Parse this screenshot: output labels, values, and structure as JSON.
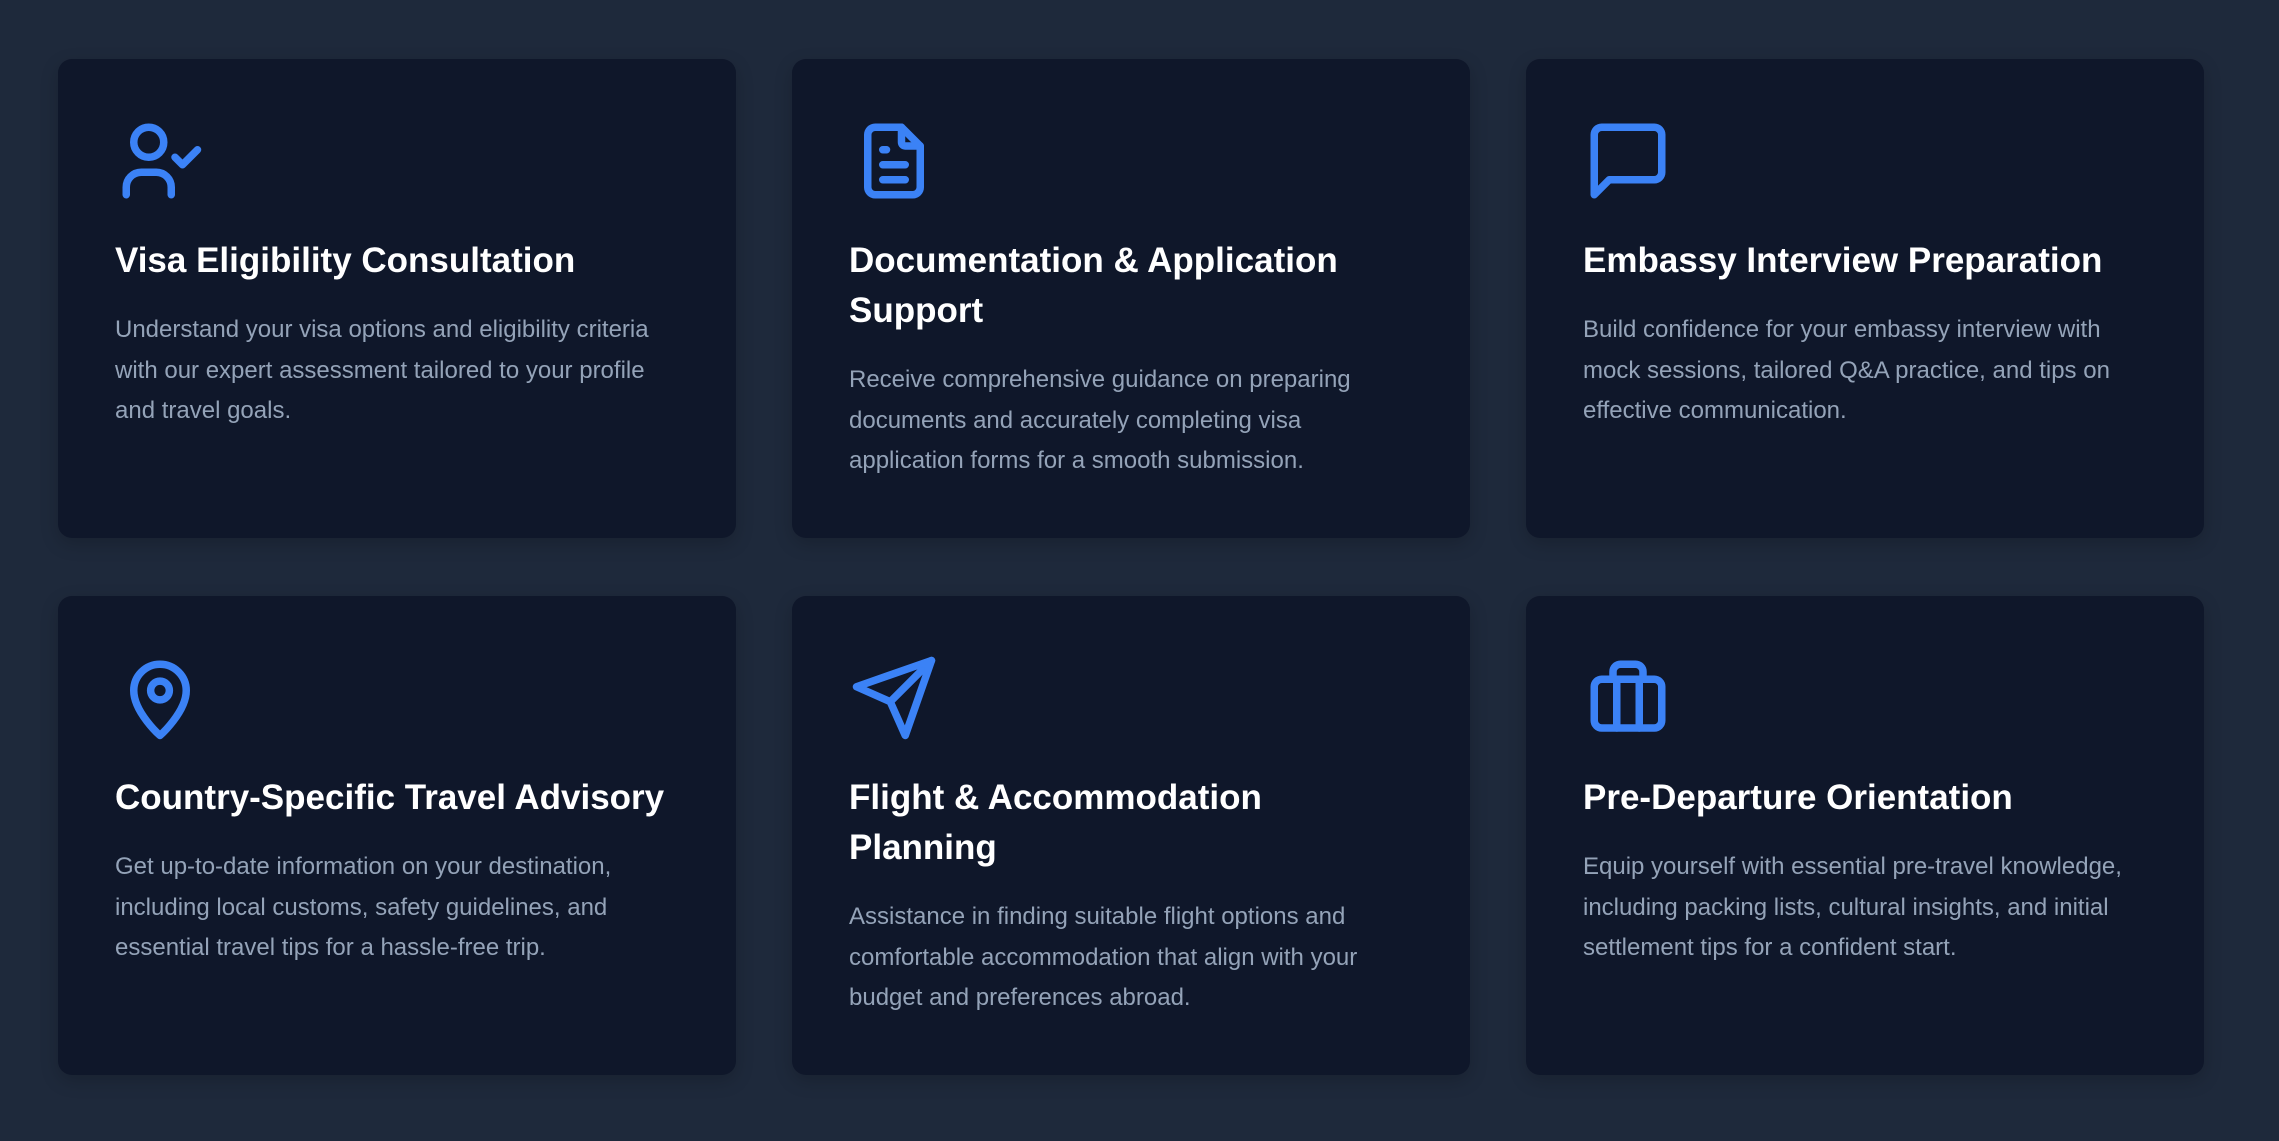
{
  "theme": {
    "background": "#1e293b",
    "card_background": "#0f172a",
    "accent": "#3b82f6",
    "title_color": "#ffffff",
    "text_color": "#94a3b8"
  },
  "services": [
    {
      "icon": "user-check-icon",
      "title": "Visa Eligibility Consultation",
      "description": "Understand your visa options and eligibility criteria with our expert assessment tailored to your profile and travel goals."
    },
    {
      "icon": "document-icon",
      "title": "Documentation & Application Support",
      "description": "Receive comprehensive guidance on preparing documents and accurately completing visa application forms for a smooth submission."
    },
    {
      "icon": "chat-bubble-icon",
      "title": "Embassy Interview Preparation",
      "description": "Build confidence for your embassy interview with mock sessions, tailored Q&A practice, and tips on effective communication."
    },
    {
      "icon": "map-pin-icon",
      "title": "Country-Specific Travel Advisory",
      "description": "Get up-to-date information on your destination, including local customs, safety guidelines, and essential travel tips for a hassle-free trip."
    },
    {
      "icon": "paper-plane-icon",
      "title": "Flight & Accommodation Planning",
      "description": "Assistance in finding suitable flight options and comfortable accommodation that align with your budget and preferences abroad."
    },
    {
      "icon": "briefcase-icon",
      "title": "Pre-Departure Orientation",
      "description": "Equip yourself with essential pre-travel knowledge, including packing lists, cultural insights, and initial settlement tips for a confident start."
    }
  ]
}
